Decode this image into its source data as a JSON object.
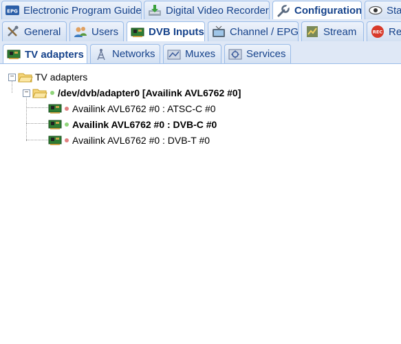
{
  "top_tabs": [
    {
      "label": "Electronic Program Guide",
      "icon": "epg-icon",
      "icon_text": "EPG"
    },
    {
      "label": "Digital Video Recorder",
      "icon": "dvr-download-icon"
    },
    {
      "label": "Configuration",
      "icon": "wrench-icon",
      "active": true
    },
    {
      "label": "Sta",
      "icon": "eye-icon"
    }
  ],
  "config_tabs": [
    {
      "label": "General",
      "icon": "tools-icon"
    },
    {
      "label": "Users",
      "icon": "users-icon"
    },
    {
      "label": "DVB Inputs",
      "icon": "dvb-card-icon",
      "active": true
    },
    {
      "label": "Channel / EPG",
      "icon": "tv-icon"
    },
    {
      "label": "Stream",
      "icon": "stream-icon"
    },
    {
      "label": "Rec",
      "icon": "rec-icon",
      "icon_text": "REC"
    }
  ],
  "dvb_tabs": [
    {
      "label": "TV adapters",
      "icon": "adapter-card-icon",
      "active": true
    },
    {
      "label": "Networks",
      "icon": "antenna-icon"
    },
    {
      "label": "Muxes",
      "icon": "muxes-icon"
    },
    {
      "label": "Services",
      "icon": "services-icon"
    }
  ],
  "tree": {
    "root": {
      "label": "TV adapters"
    },
    "adapter": {
      "label": "/dev/dvb/adapter0 [Availink AVL6762 #0]",
      "status": "ok"
    },
    "frontends": [
      {
        "label": "Availink AVL6762 #0 : ATSC-C #0",
        "status": "off",
        "bold": false
      },
      {
        "label": "Availink AVL6762 #0 : DVB-C #0",
        "status": "ok",
        "bold": true
      },
      {
        "label": "Availink AVL6762 #0 : DVB-T #0",
        "status": "off",
        "bold": false
      }
    ]
  },
  "colors": {
    "status_ok": "#8fd47a",
    "status_off": "#e08080",
    "accent": "#15428b",
    "panel_bg": "#dfe8f6",
    "border": "#99bbe8"
  }
}
